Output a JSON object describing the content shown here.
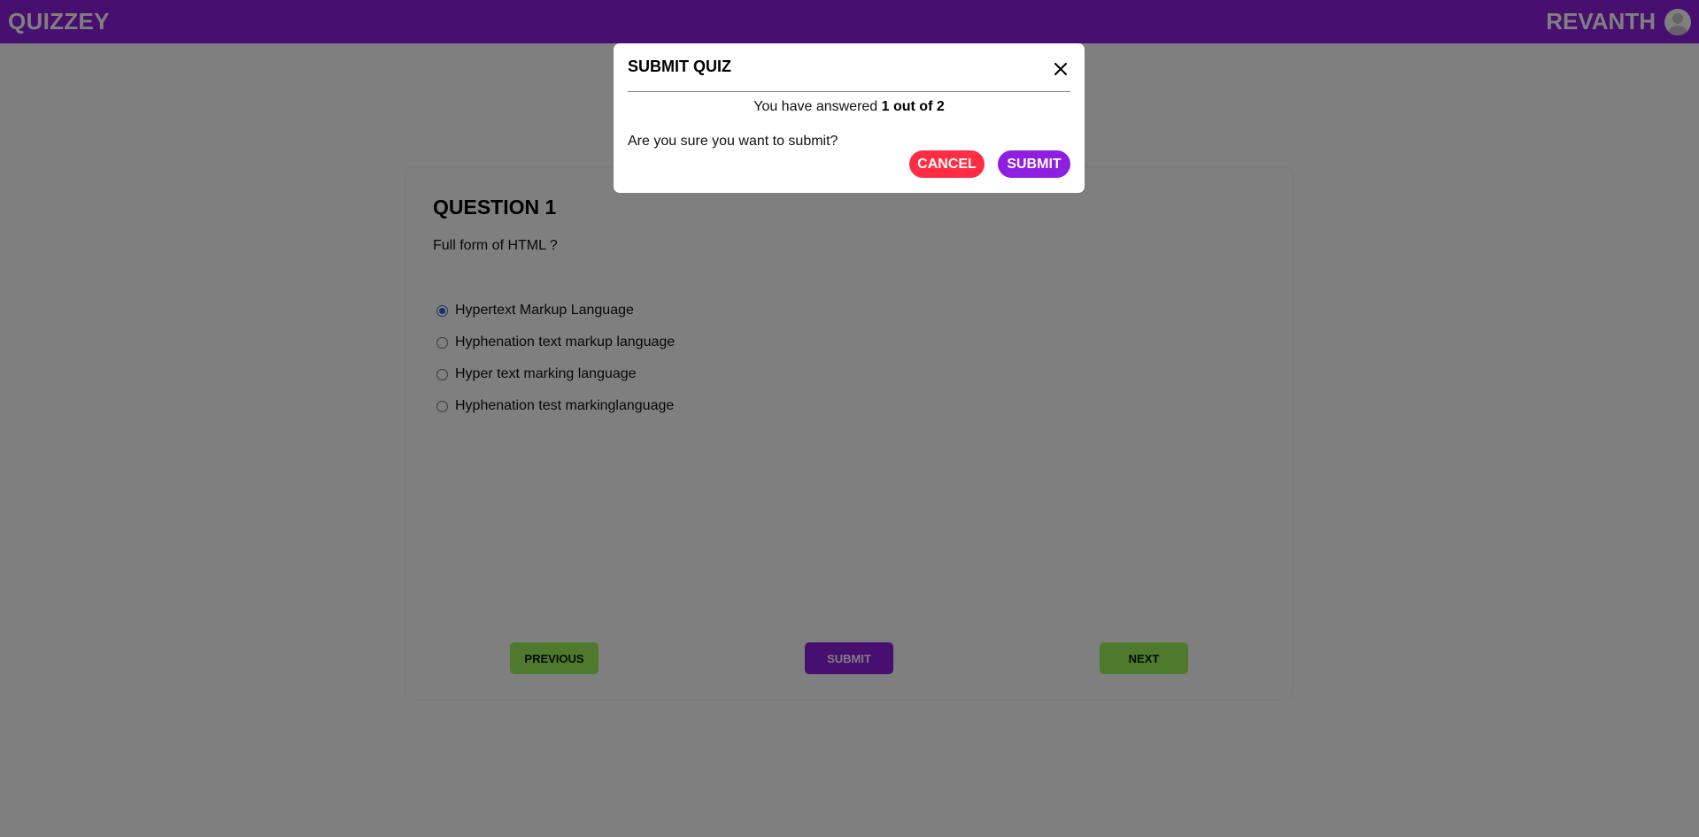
{
  "header": {
    "brand": "QUIZZEY",
    "username": "REVANTH",
    "avatar_icon": "user-avatar-icon"
  },
  "question": {
    "title": "QUESTION 1",
    "text": "Full form of HTML ?",
    "options": [
      {
        "label": "Hypertext Markup Language",
        "selected": true
      },
      {
        "label": "Hyphenation text markup language",
        "selected": false
      },
      {
        "label": "Hyper text marking language",
        "selected": false
      },
      {
        "label": "Hyphenation test markinglanguage",
        "selected": false
      }
    ]
  },
  "navigation": {
    "previous_label": "PREVIOUS",
    "submit_label": "SUBMIT",
    "next_label": "NEXT"
  },
  "modal": {
    "title": "SUBMIT QUIZ",
    "close_icon": "close-icon",
    "answered_prefix": "You have answered",
    "answered_count": "1 out of 2",
    "confirm_text": "Are you sure you want to submit?",
    "cancel_label": "CANCEL",
    "submit_label": "SUBMIT"
  },
  "colors": {
    "brand_purple": "#8e1ee0",
    "nav_green": "#9ff55a",
    "cancel_red": "#fe2d43",
    "backdrop": "rgba(0,0,0,0.5)"
  }
}
